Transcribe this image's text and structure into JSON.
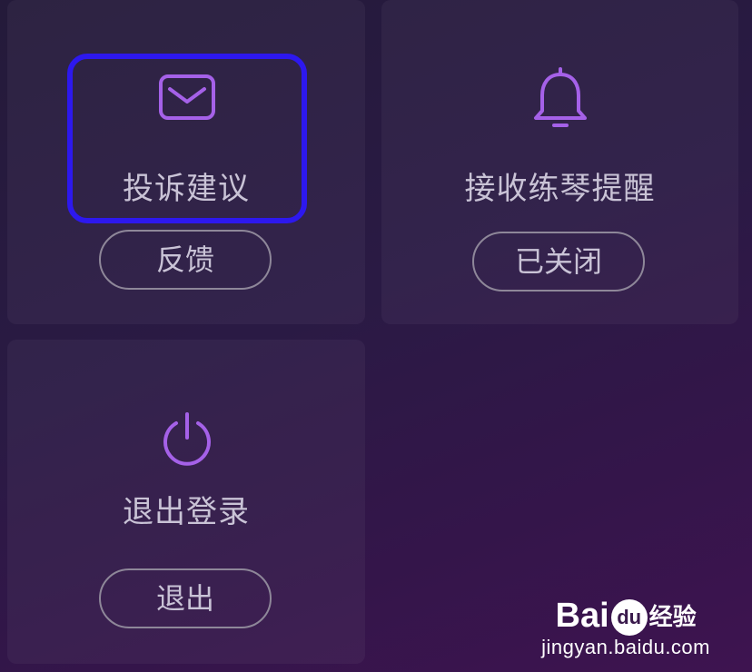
{
  "cards": {
    "feedback": {
      "title": "投诉建议",
      "button": "反馈",
      "icon": "mail-icon"
    },
    "reminder": {
      "title": "接收练琴提醒",
      "button": "已关闭",
      "icon": "bell-icon"
    },
    "logout": {
      "title": "退出登录",
      "button": "退出",
      "icon": "power-icon"
    }
  },
  "colors": {
    "icon_accent": "#a561e8",
    "text": "#c9c3d6",
    "highlight": "#2d18ee",
    "pill_border": "#8e8799"
  },
  "watermark": {
    "brand_part1": "Bai",
    "brand_part2": "du",
    "brand_part3": "经验",
    "url": "jingyan.baidu.com"
  }
}
